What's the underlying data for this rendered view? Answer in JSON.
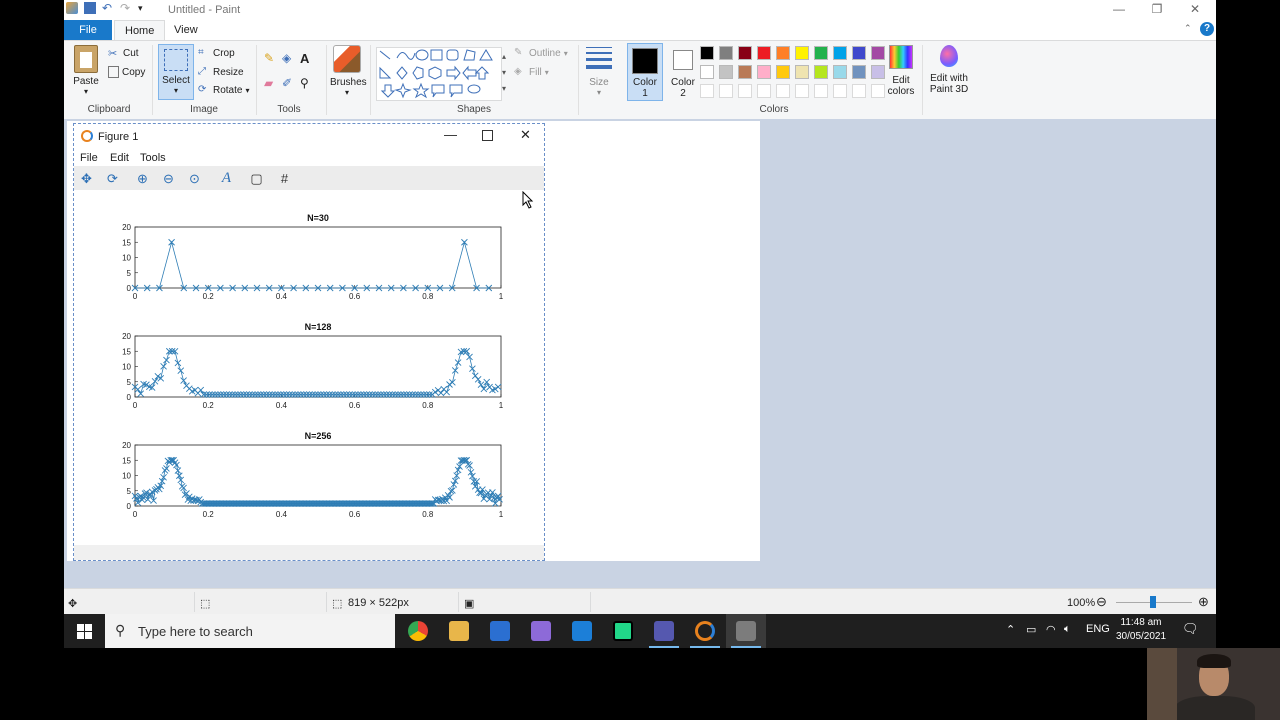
{
  "window": {
    "title": "Untitled - Paint"
  },
  "tabs": {
    "file": "File",
    "home": "Home",
    "view": "View"
  },
  "ribbon": {
    "clipboard": {
      "paste": "Paste",
      "cut": "Cut",
      "copy": "Copy",
      "label": "Clipboard"
    },
    "image": {
      "select": "Select",
      "crop": "Crop",
      "resize": "Resize",
      "rotate": "Rotate",
      "label": "Image"
    },
    "tools": {
      "label": "Tools"
    },
    "brushes": {
      "label": "Brushes"
    },
    "shapes": {
      "outline": "Outline",
      "fill": "Fill",
      "label": "Shapes"
    },
    "size": {
      "label": "Size"
    },
    "color1": {
      "line1": "Color",
      "line2": "1"
    },
    "color2": {
      "line1": "Color",
      "line2": "2"
    },
    "colors": {
      "label": "Colors",
      "row1": [
        "#000000",
        "#7f7f7f",
        "#880015",
        "#ed1c24",
        "#ff7f27",
        "#fff200",
        "#22b14c",
        "#00a2e8",
        "#3f48cc",
        "#a349a4"
      ],
      "row2": [
        "#ffffff",
        "#c3c3c3",
        "#b97a57",
        "#ffaec9",
        "#ffc90e",
        "#efe4b0",
        "#b5e61d",
        "#99d9ea",
        "#7092be",
        "#c8bfe7"
      ]
    },
    "edit_colors": {
      "line1": "Edit",
      "line2": "colors"
    },
    "paint3d": {
      "line1": "Edit with",
      "line2": "Paint 3D"
    }
  },
  "figure": {
    "title": "Figure 1",
    "menu": [
      "File",
      "Edit",
      "Tools"
    ]
  },
  "chart_data": [
    {
      "type": "line",
      "title": "N=30",
      "ylim": [
        0,
        20
      ],
      "xlim": [
        0,
        1
      ],
      "yticks": [
        "0",
        "5",
        "10",
        "15",
        "20"
      ],
      "xticks": [
        "0",
        "0.2",
        "0.4",
        "0.6",
        "0.8",
        "1"
      ],
      "marker": "x",
      "color": "#2e7db5",
      "x": [
        0,
        0.0333,
        0.0667,
        0.1,
        0.1333,
        0.1667,
        0.2,
        0.2333,
        0.2667,
        0.3,
        0.3333,
        0.3667,
        0.4,
        0.4333,
        0.4667,
        0.5,
        0.5333,
        0.5667,
        0.6,
        0.6333,
        0.6667,
        0.7,
        0.7333,
        0.7667,
        0.8,
        0.8333,
        0.8667,
        0.9,
        0.9333,
        0.9667
      ],
      "y": [
        0,
        0,
        0,
        15,
        0,
        0,
        0,
        0,
        0,
        0,
        0,
        0,
        0,
        0,
        0,
        0,
        0,
        0,
        0,
        0,
        0,
        0,
        0,
        0,
        0,
        0,
        0,
        15,
        0,
        0
      ]
    },
    {
      "type": "line",
      "title": "N=128",
      "ylim": [
        0,
        20
      ],
      "xlim": [
        0,
        1
      ],
      "yticks": [
        "0",
        "5",
        "10",
        "15",
        "20"
      ],
      "xticks": [
        "0",
        "0.2",
        "0.4",
        "0.6",
        "0.8",
        "1"
      ],
      "marker": "x",
      "color": "#2e7db5",
      "peak": 15,
      "peak_positions": [
        0.1,
        0.9
      ],
      "floor": 0.8
    },
    {
      "type": "line",
      "title": "N=256",
      "ylim": [
        0,
        20
      ],
      "xlim": [
        0,
        1
      ],
      "yticks": [
        "0",
        "5",
        "10",
        "15",
        "20"
      ],
      "xticks": [
        "0",
        "0.2",
        "0.4",
        "0.6",
        "0.8",
        "1"
      ],
      "marker": "x",
      "color": "#2e7db5",
      "peak": 15,
      "peak_positions": [
        0.1,
        0.9
      ],
      "floor": 0.8
    }
  ],
  "statusbar": {
    "size": "819 × 522px",
    "zoom": "100%"
  },
  "taskbar": {
    "search_placeholder": "Type here to search",
    "lang": "ENG",
    "time": "11:48 am",
    "date": "30/05/2021"
  }
}
